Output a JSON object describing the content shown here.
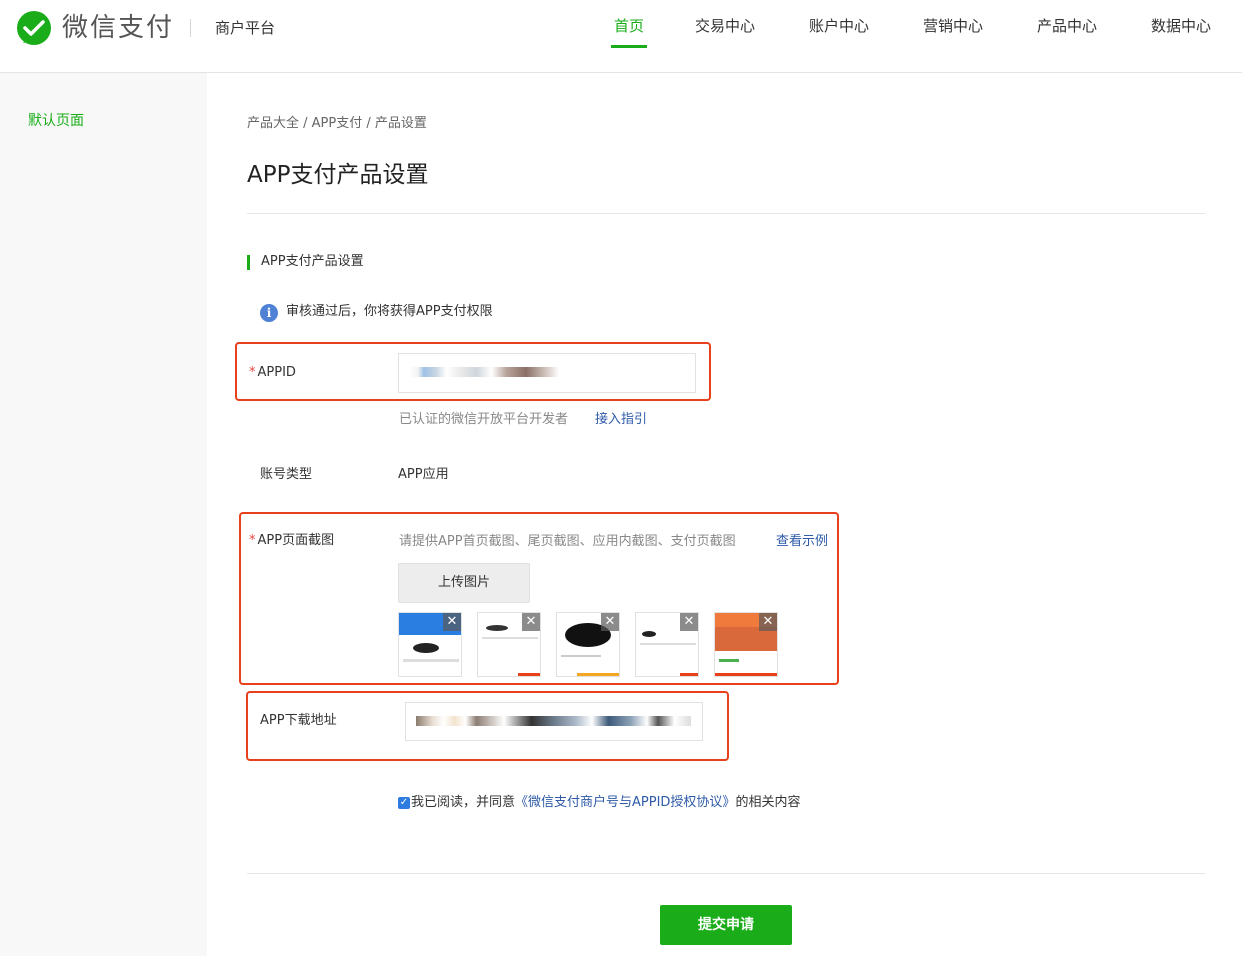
{
  "header": {
    "brand": "微信支付",
    "subbrand": "商户平台",
    "nav": [
      {
        "label": "首页",
        "active": true
      },
      {
        "label": "交易中心"
      },
      {
        "label": "账户中心"
      },
      {
        "label": "营销中心"
      },
      {
        "label": "产品中心"
      },
      {
        "label": "数据中心"
      }
    ]
  },
  "sidebar": {
    "items": [
      {
        "label": "默认页面"
      }
    ]
  },
  "breadcrumb": "产品大全 / APP支付 / 产品设置",
  "page_title": "APP支付产品设置",
  "section_title": "APP支付产品设置",
  "info_text": "审核通过后，你将获得APP支付权限",
  "form": {
    "required_mark": "*",
    "appid_label": "APPID",
    "appid_hint": "已认证的微信开放平台开发者",
    "appid_link": "接入指引",
    "account_type_label": "账号类型",
    "account_type_value": "APP应用",
    "screenshot_label": "APP页面截图",
    "screenshot_hint": "请提供APP首页截图、尾页截图、应用内截图、支付页截图",
    "screenshot_link": "查看示例",
    "upload_button": "上传图片",
    "remove_glyph": "✕",
    "download_label": "APP下载地址",
    "agree_prefix": "我已阅读，并同意",
    "agree_link": "《微信支付商户号与APPID授权协议》",
    "agree_suffix": "的相关内容",
    "agree_checked": true,
    "submit_button": "提交申请"
  },
  "colors": {
    "accent": "#1aad19",
    "link": "#2e5aa8",
    "highlight": "#e8401a",
    "info": "#4f82d5"
  }
}
